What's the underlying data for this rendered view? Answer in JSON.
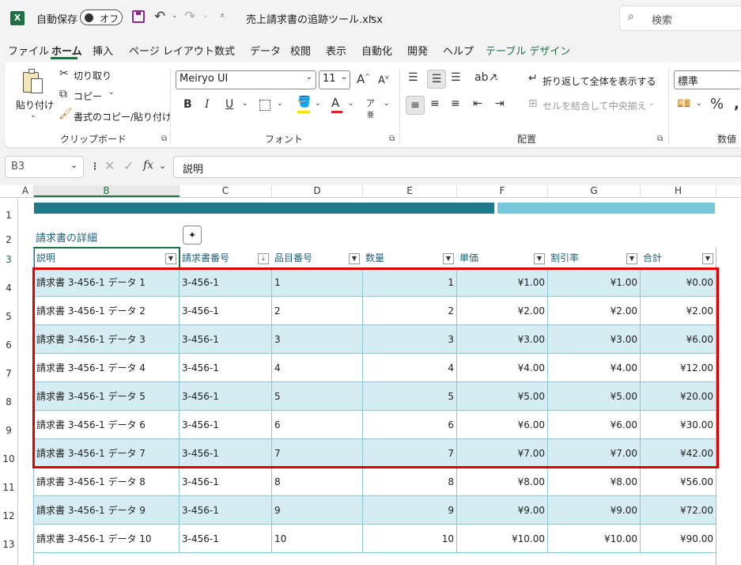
{
  "titlebar": {
    "autosave_label": "自動保存",
    "autosave_state": "オフ",
    "filename": "売上請求書の追跡ツール.xlsx",
    "search_placeholder": "検索"
  },
  "tabs": [
    "ファイル",
    "ホーム",
    "挿入",
    "ページ レイアウト",
    "数式",
    "データ",
    "校閲",
    "表示",
    "自動化",
    "開発",
    "ヘルプ",
    "テーブル デザイン"
  ],
  "ribbon": {
    "clipboard": {
      "paste": "貼り付け",
      "cut": "切り取り",
      "copy": "コピー",
      "format_painter": "書式のコピー/貼り付け",
      "group": "クリップボード"
    },
    "font": {
      "name": "Meiryo UI",
      "size": "11",
      "group": "フォント"
    },
    "alignment": {
      "wrap": "折り返して全体を表示する",
      "merge": "セルを結合して中央揃え",
      "group": "配置"
    },
    "number": {
      "format": "標準",
      "group": "数値"
    }
  },
  "formula_bar": {
    "cell_ref": "B3",
    "fx": "fx",
    "content": "説明"
  },
  "columns": [
    "A",
    "B",
    "C",
    "D",
    "E",
    "F",
    "G",
    "H"
  ],
  "sheet": {
    "table_title": "請求書の詳細",
    "headers": [
      "説明",
      "請求書番号",
      "品目番号",
      "数量",
      "単価",
      "割引率",
      "合計"
    ],
    "rows": [
      [
        "請求書 3-456-1 データ 1",
        "3-456-1",
        "1",
        "1",
        "¥1.00",
        "¥1.00",
        "¥0.00"
      ],
      [
        "請求書 3-456-1 データ 2",
        "3-456-1",
        "2",
        "2",
        "¥2.00",
        "¥2.00",
        "¥2.00"
      ],
      [
        "請求書 3-456-1 データ 3",
        "3-456-1",
        "3",
        "3",
        "¥3.00",
        "¥3.00",
        "¥6.00"
      ],
      [
        "請求書 3-456-1 データ 4",
        "3-456-1",
        "4",
        "4",
        "¥4.00",
        "¥4.00",
        "¥12.00"
      ],
      [
        "請求書 3-456-1 データ 5",
        "3-456-1",
        "5",
        "5",
        "¥5.00",
        "¥5.00",
        "¥20.00"
      ],
      [
        "請求書 3-456-1 データ 6",
        "3-456-1",
        "6",
        "6",
        "¥6.00",
        "¥6.00",
        "¥30.00"
      ],
      [
        "請求書 3-456-1 データ 7",
        "3-456-1",
        "7",
        "7",
        "¥7.00",
        "¥7.00",
        "¥42.00"
      ],
      [
        "請求書 3-456-1 データ 8",
        "3-456-1",
        "8",
        "8",
        "¥8.00",
        "¥8.00",
        "¥56.00"
      ],
      [
        "請求書 3-456-1 データ 9",
        "3-456-1",
        "9",
        "9",
        "¥9.00",
        "¥9.00",
        "¥72.00"
      ],
      [
        "請求書 3-456-1 データ 10",
        "3-456-1",
        "10",
        "10",
        "¥10.00",
        "¥10.00",
        "¥90.00"
      ]
    ],
    "row_numbers": [
      "1",
      "2",
      "3",
      "4",
      "5",
      "6",
      "7",
      "8",
      "9",
      "10",
      "11",
      "12",
      "13"
    ]
  },
  "colors": {
    "accent_green": "#1e7145",
    "band_dark": "#22788a",
    "band_light": "#78c6da",
    "row_tint": "#d5ecf3",
    "highlight": "#e00000"
  }
}
